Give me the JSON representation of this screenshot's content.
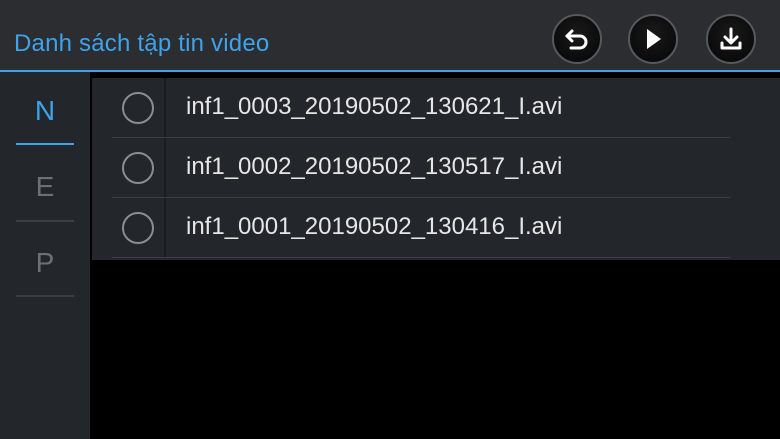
{
  "header": {
    "title": "Danh sách tập tin video",
    "buttons": [
      {
        "name": "back-button",
        "icon": "undo-arrow-icon"
      },
      {
        "name": "play-button",
        "icon": "play-icon"
      },
      {
        "name": "download-button",
        "icon": "download-icon"
      }
    ]
  },
  "sidebar": {
    "tabs": [
      {
        "label": "N",
        "active": true
      },
      {
        "label": "E",
        "active": false
      },
      {
        "label": "P",
        "active": false
      }
    ]
  },
  "file_list": {
    "items": [
      {
        "filename": "inf1_0003_20190502_130621_I.avi",
        "selected": false
      },
      {
        "filename": "inf1_0002_20190502_130517_I.avi",
        "selected": false
      },
      {
        "filename": "inf1_0001_20190502_130416_I.avi",
        "selected": false
      }
    ]
  },
  "colors": {
    "accent": "#3ea3ea",
    "panel": "#23262a",
    "header": "#2b2d30",
    "background": "#000000"
  }
}
